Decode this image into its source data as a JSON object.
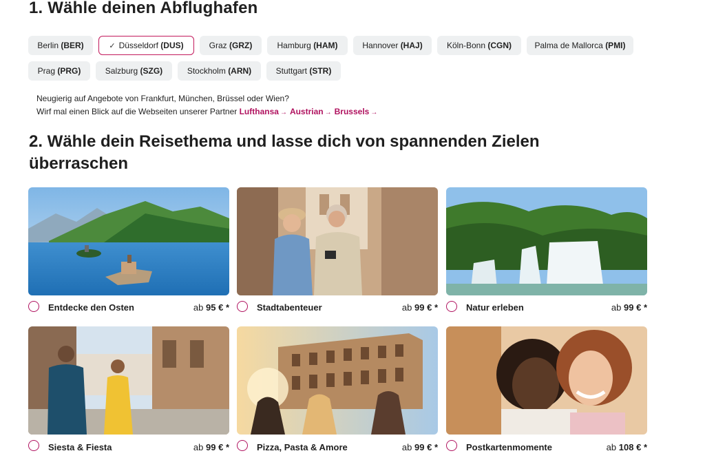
{
  "section1": {
    "heading": "1. Wähle deinen Abflughafen",
    "airports": [
      {
        "city": "Berlin",
        "code": "(BER)",
        "selected": false
      },
      {
        "city": "Düsseldorf",
        "code": "(DUS)",
        "selected": true
      },
      {
        "city": "Graz",
        "code": "(GRZ)",
        "selected": false
      },
      {
        "city": "Hamburg",
        "code": "(HAM)",
        "selected": false
      },
      {
        "city": "Hannover",
        "code": "(HAJ)",
        "selected": false
      },
      {
        "city": "Köln-Bonn",
        "code": "(CGN)",
        "selected": false
      },
      {
        "city": "Palma de Mallorca",
        "code": "(PMI)",
        "selected": false
      },
      {
        "city": "Prag",
        "code": "(PRG)",
        "selected": false
      },
      {
        "city": "Salzburg",
        "code": "(SZG)",
        "selected": false
      },
      {
        "city": "Stockholm",
        "code": "(ARN)",
        "selected": false
      },
      {
        "city": "Stuttgart",
        "code": "(STR)",
        "selected": false
      }
    ],
    "check_mark": "✓",
    "info_line1": "Neugierig auf Angebote von Frankfurt, München, Brüssel oder Wien?",
    "info_line2": "Wirf mal einen Blick auf die Webseiten unserer Partner",
    "partners": [
      "Lufthansa",
      "Austrian",
      "Brussels"
    ],
    "partner_arrow": "→"
  },
  "section2": {
    "heading": "2. Wähle dein Reisethema und lasse dich von spannenden Zielen überraschen",
    "themes": [
      {
        "title": "Entdecke den Osten",
        "price_prefix": "ab",
        "price": "95 €",
        "asterisk": "*"
      },
      {
        "title": "Stadtabenteuer",
        "price_prefix": "ab",
        "price": "99 €",
        "asterisk": "*"
      },
      {
        "title": "Natur erleben",
        "price_prefix": "ab",
        "price": "99 €",
        "asterisk": "*"
      },
      {
        "title": "Siesta & Fiesta",
        "price_prefix": "ab",
        "price": "99 €",
        "asterisk": "*"
      },
      {
        "title": "Pizza, Pasta & Amore",
        "price_prefix": "ab",
        "price": "99 €",
        "asterisk": "*"
      },
      {
        "title": "Postkartenmomente",
        "price_prefix": "ab",
        "price": "108 €",
        "asterisk": "*"
      }
    ]
  },
  "colors": {
    "accent": "#b0125f",
    "chip_bg": "#eef0f1",
    "text": "#1f1f1f"
  }
}
